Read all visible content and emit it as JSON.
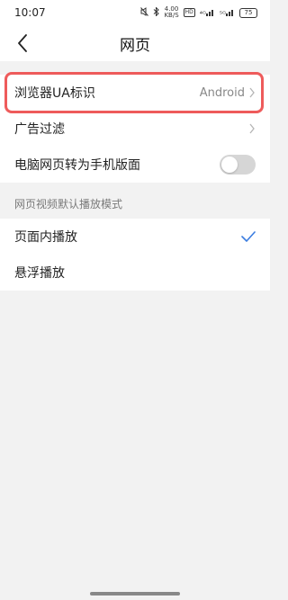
{
  "status_bar": {
    "time": "10:07",
    "net_speed_value": "4.00",
    "net_speed_unit": "KB/S",
    "hd_label": "HD",
    "signal_1": "⁴ᴳ",
    "signal_2": "⁵ᴳ",
    "battery": "75"
  },
  "header": {
    "title": "网页"
  },
  "settings_top": [
    {
      "label": "浏览器UA标识",
      "value": "Android"
    },
    {
      "label": "广告过滤"
    },
    {
      "label": "电脑网页转为手机版面",
      "toggle": false
    }
  ],
  "video_section": {
    "header": "网页视频默认播放模式",
    "options": [
      {
        "label": "页面内播放",
        "selected": true
      },
      {
        "label": "悬浮播放",
        "selected": false
      }
    ]
  },
  "colors": {
    "highlight": "#ee5b5b",
    "check": "#3b7de0"
  }
}
